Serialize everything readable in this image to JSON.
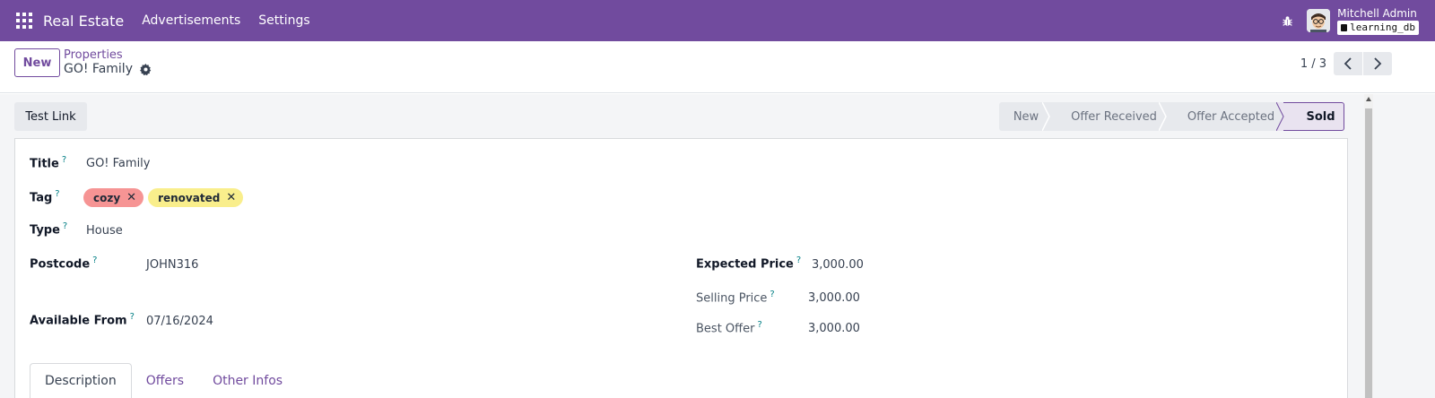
{
  "navbar": {
    "app_name": "Real Estate",
    "menus": [
      "Advertisements",
      "Settings"
    ],
    "user_name": "Mitchell Admin",
    "database": "learning_db"
  },
  "control": {
    "new_label": "New",
    "breadcrumb": "Properties",
    "record_name": "GO! Family",
    "pager_value": "1 / 3"
  },
  "header": {
    "action_button": "Test Link",
    "stages": [
      "New",
      "Offer Received",
      "Offer Accepted",
      "Sold"
    ],
    "active_stage": "Sold"
  },
  "form": {
    "title": {
      "label": "Title",
      "value": "GO! Family"
    },
    "tag": {
      "label": "Tag",
      "tags": [
        {
          "name": "cozy",
          "color": "#f69494"
        },
        {
          "name": "renovated",
          "color": "#f9ee8c"
        }
      ]
    },
    "type": {
      "label": "Type",
      "value": "House"
    },
    "postcode": {
      "label": "Postcode",
      "value": "JOHN316"
    },
    "available_from": {
      "label": "Available From",
      "value": "07/16/2024"
    },
    "expected_price": {
      "label": "Expected Price",
      "value": "3,000.00"
    },
    "selling_price": {
      "label": "Selling Price",
      "value": "3,000.00"
    },
    "best_offer": {
      "label": "Best Offer",
      "value": "3,000.00"
    },
    "help_marker": "?"
  },
  "tabs": [
    {
      "label": "Description",
      "active": true
    },
    {
      "label": "Offers",
      "active": false
    },
    {
      "label": "Other Infos",
      "active": false
    }
  ],
  "colors": {
    "brand": "#714b9e",
    "help": "#017e84"
  }
}
